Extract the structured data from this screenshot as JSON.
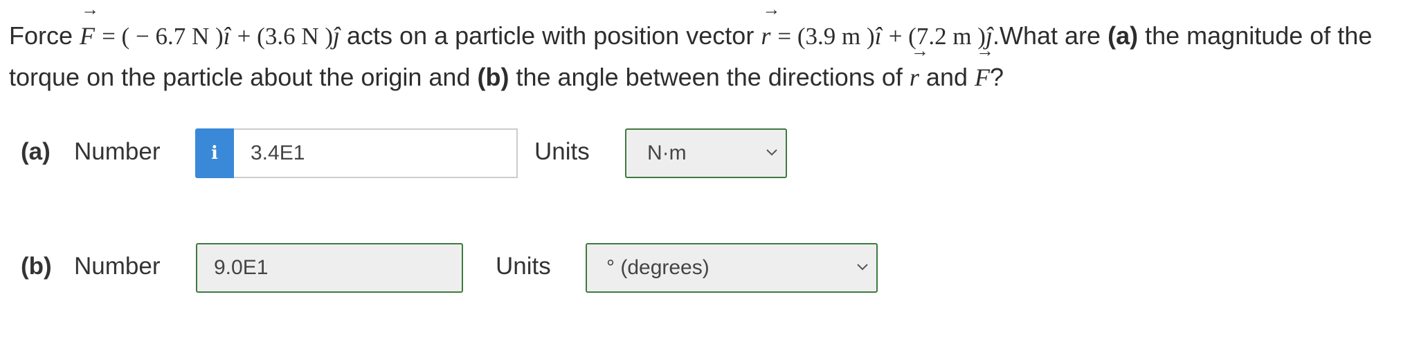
{
  "question": {
    "t_force": "Force",
    "t_eq1": "= ( − 6.7  N )",
    "t_plus1": "+ (3.6  N )",
    "t_mid": "acts on a particle with position vector",
    "t_eq2": "= (3.9  m )",
    "t_plus2": "+ (7.2  m )",
    "t_dot": ".",
    "t_what": "What are",
    "a_bold": "(a)",
    "t_the": "the",
    "t_line2": "magnitude of the torque on the particle about the origin and",
    "b_bold": "(b)",
    "t_angle": "the angle between the directions of",
    "t_and": "and",
    "t_q": "?",
    "sym_F": "F",
    "sym_r": "r",
    "sym_i": "î",
    "sym_j": "ĵ",
    "arrow": "→"
  },
  "part_a": {
    "label": "(a)",
    "number_label": "Number",
    "info_glyph": "i",
    "value": "3.4E1",
    "units_label": "Units",
    "units_value": "N·m"
  },
  "part_b": {
    "label": "(b)",
    "number_label": "Number",
    "value": "9.0E1",
    "units_label": "Units",
    "units_value": "° (degrees)"
  },
  "colors": {
    "info_button": "#3a88d8",
    "correct_border": "#3d7a3d",
    "field_bg": "#eeeeee"
  }
}
